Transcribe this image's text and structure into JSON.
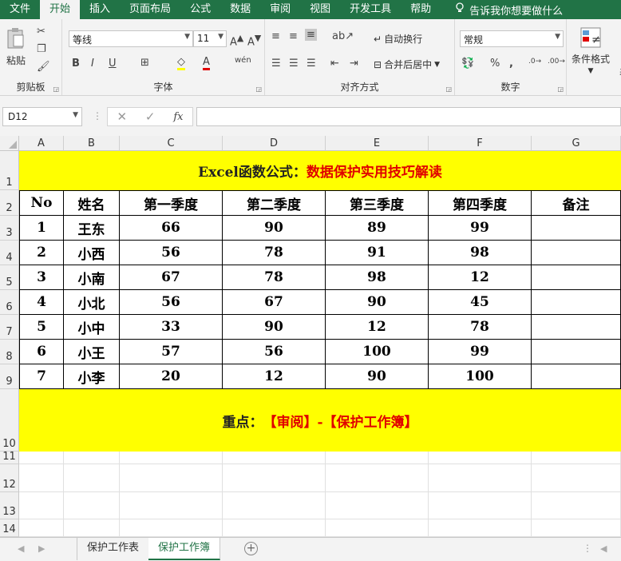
{
  "tabs": [
    "文件",
    "开始",
    "插入",
    "页面布局",
    "公式",
    "数据",
    "审阅",
    "视图",
    "开发工具",
    "帮助"
  ],
  "active_tab": "开始",
  "tell_me": "告诉我你想要做什么",
  "ribbon": {
    "clipboard": {
      "label": "剪贴板",
      "paste": "粘贴"
    },
    "font": {
      "label": "字体",
      "name": "等线",
      "size": "11"
    },
    "alignment": {
      "label": "对齐方式",
      "wrap_text": "自动换行",
      "merge_center": "合并后居中"
    },
    "number": {
      "label": "数字",
      "format": "常规"
    },
    "styles": {
      "conditional": "条件格式",
      "table_partial": "表"
    }
  },
  "name_box": "D12",
  "fx": "fx",
  "columns": [
    "A",
    "B",
    "C",
    "D",
    "E",
    "F",
    "G"
  ],
  "rows": [
    "1",
    "2",
    "3",
    "4",
    "5",
    "6",
    "7",
    "8",
    "9",
    "10",
    "11",
    "12",
    "13",
    "14"
  ],
  "title": {
    "black": "Excel函数公式：",
    "red": "数据保护实用技巧解读"
  },
  "headers": [
    "No",
    "姓名",
    "第一季度",
    "第二季度",
    "第三季度",
    "第四季度",
    "备注"
  ],
  "table": [
    [
      "1",
      "王东",
      "66",
      "90",
      "89",
      "99",
      ""
    ],
    [
      "2",
      "小西",
      "56",
      "78",
      "91",
      "98",
      ""
    ],
    [
      "3",
      "小南",
      "67",
      "78",
      "98",
      "12",
      ""
    ],
    [
      "4",
      "小北",
      "56",
      "67",
      "90",
      "45",
      ""
    ],
    [
      "5",
      "小中",
      "33",
      "90",
      "12",
      "78",
      ""
    ],
    [
      "6",
      "小王",
      "57",
      "56",
      "100",
      "99",
      ""
    ],
    [
      "7",
      "小李",
      "20",
      "12",
      "90",
      "100",
      ""
    ]
  ],
  "note": {
    "black": "重点：",
    "red": "【审阅】-【保护工作簿】"
  },
  "sheet_tabs": [
    "保护工作表",
    "保护工作簿"
  ],
  "active_sheet": "保护工作簿",
  "colors": {
    "accent": "#217346",
    "band": "#ffff00",
    "title_red": "#e00000"
  }
}
